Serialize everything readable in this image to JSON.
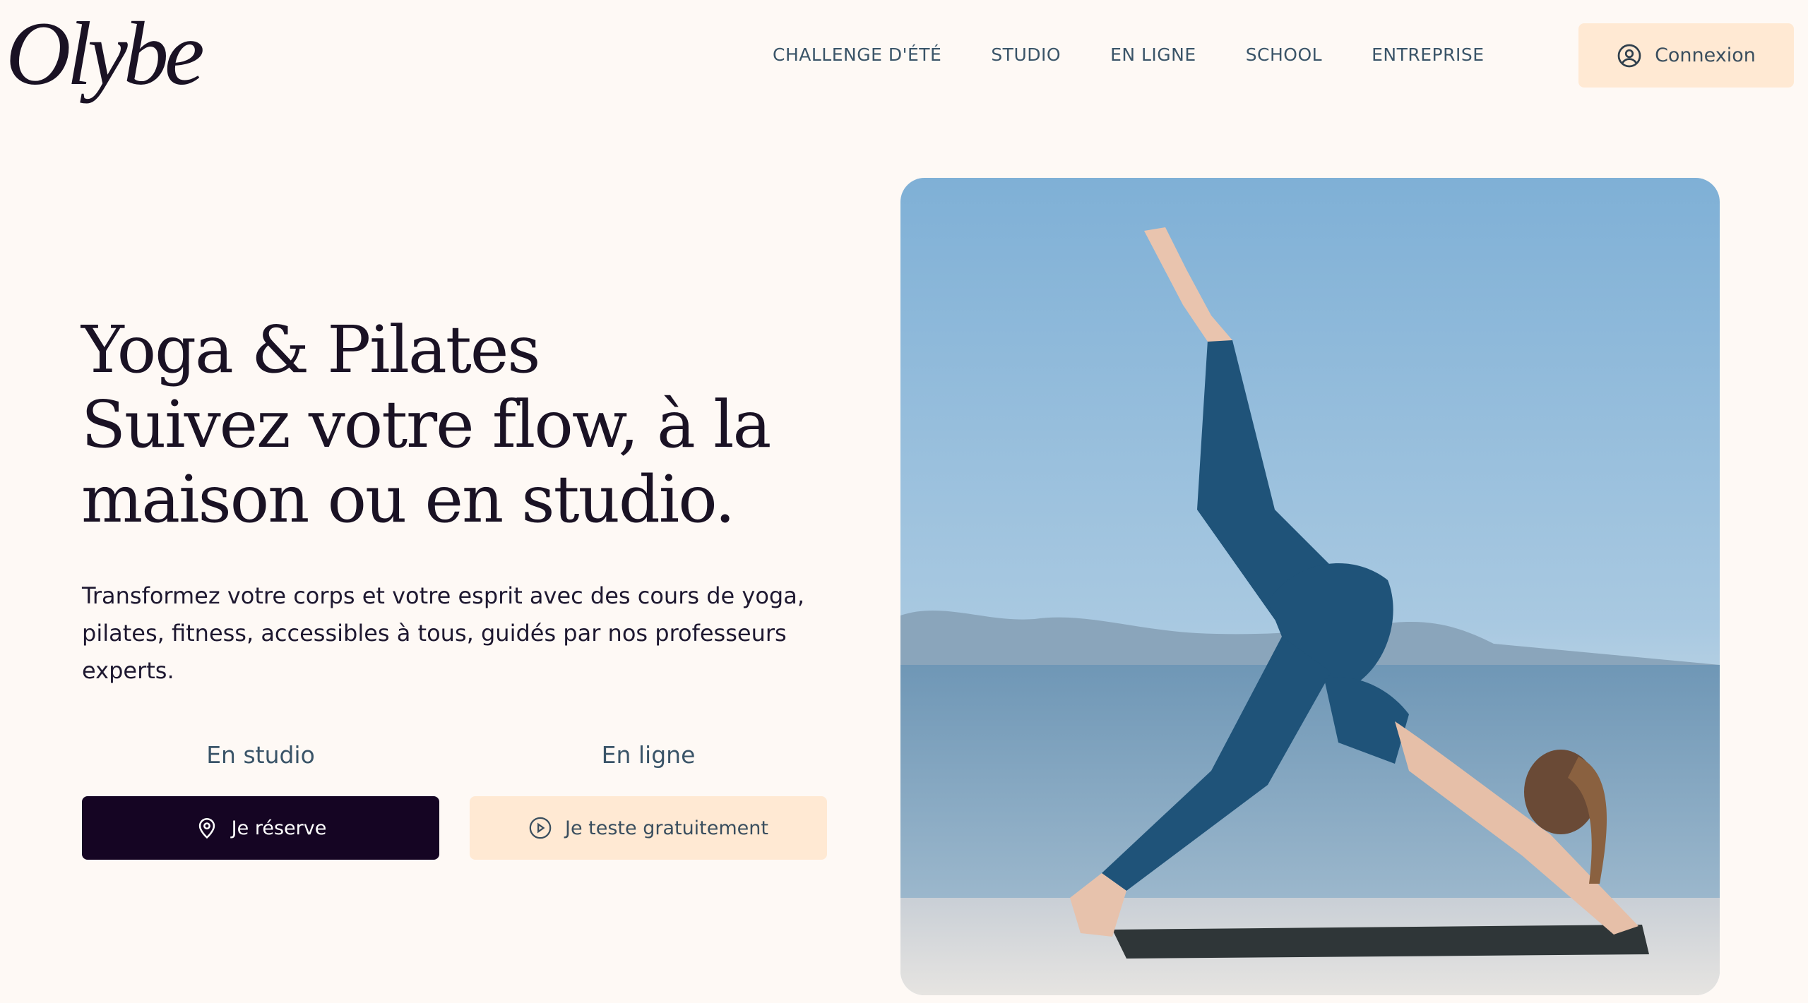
{
  "brand": {
    "logo_text": "Olybe"
  },
  "nav": {
    "items": [
      {
        "label": "CHALLENGE D'ÉTÉ"
      },
      {
        "label": "STUDIO"
      },
      {
        "label": "EN LIGNE"
      },
      {
        "label": "SCHOOL"
      },
      {
        "label": "ENTREPRISE"
      }
    ]
  },
  "header": {
    "login_label": "Connexion",
    "login_icon": "user-circle-icon"
  },
  "hero": {
    "title_lines": [
      "Yoga & Pilates",
      "Suivez votre flow, à la",
      "maison ou en studio."
    ],
    "description": "Transformez votre corps et votre esprit avec des cours de yoga, pilates, fitness, accessibles à tous, guidés par nos professeurs experts.",
    "studio": {
      "label": "En studio",
      "button": "Je réserve",
      "icon": "location-pin-icon"
    },
    "online": {
      "label": "En ligne",
      "button": "Je teste gratuitement",
      "icon": "play-circle-icon"
    }
  },
  "colors": {
    "background": "#fef9f5",
    "primary_dark": "#150523",
    "accent_light": "#ffe9d3",
    "nav_text": "#3a5468"
  }
}
